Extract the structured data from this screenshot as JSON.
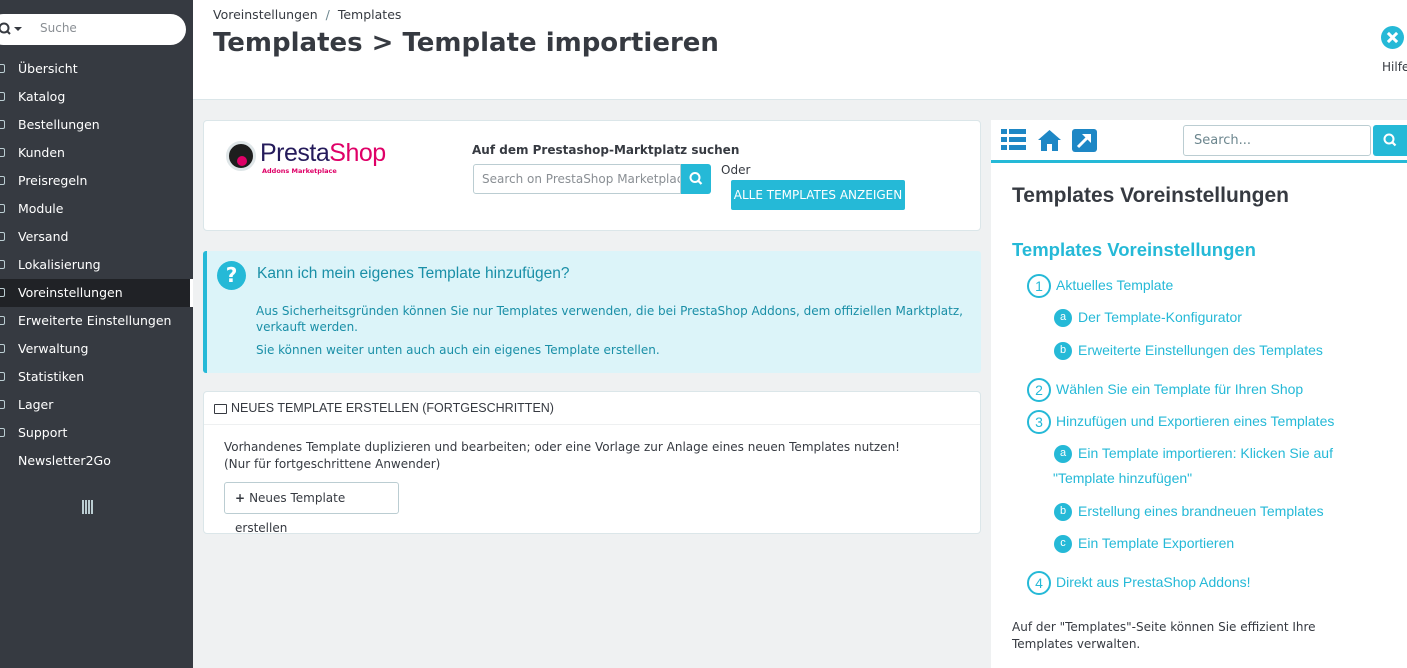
{
  "sidebar": {
    "search_placeholder": "Suche",
    "items": [
      {
        "label": "Übersicht"
      },
      {
        "label": "Katalog"
      },
      {
        "label": "Bestellungen"
      },
      {
        "label": "Kunden"
      },
      {
        "label": "Preisregeln"
      },
      {
        "label": "Module"
      },
      {
        "label": "Versand"
      },
      {
        "label": "Lokalisierung"
      },
      {
        "label": "Voreinstellungen"
      },
      {
        "label": "Erweiterte Einstellungen"
      },
      {
        "label": "Verwaltung"
      },
      {
        "label": "Statistiken"
      },
      {
        "label": "Lager"
      },
      {
        "label": "Support"
      },
      {
        "label": "Newsletter2Go"
      }
    ],
    "active_item": "Voreinstellungen"
  },
  "header": {
    "breadcrumb": [
      "Voreinstellungen",
      "/",
      "Templates"
    ],
    "title": "Templates > Template importieren",
    "help_label": "Hilfe"
  },
  "addons": {
    "logo_brand_a": "Presta",
    "logo_brand_b": "Shop",
    "logo_sub": "Addons Marketplace",
    "search_label": "Auf dem Prestashop-Marktplatz suchen",
    "search_placeholder": "Search on PrestaShop Marketplace",
    "or_label": "Oder",
    "all_templates_button": "ALLE TEMPLATES ANZEIGEN"
  },
  "info": {
    "title": "Kann ich mein eigenes Template hinzufügen?",
    "text1": "Aus Sicherheitsgründen können Sie nur Templates verwenden, die bei PrestaShop Addons, dem offiziellen Marktplatz, verkauft werden.",
    "text2": "Sie können weiter unten auch auch ein eigenes Template erstellen."
  },
  "new_template": {
    "panel_title": "NEUES TEMPLATE ERSTELLEN (FORTGESCHRITTEN)",
    "description": "Vorhandenes Template duplizieren und bearbeiten; oder eine Vorlage zur Anlage eines neuen Templates nutzen! (Nur für fortgeschrittene Anwender)",
    "button_plus": "+",
    "button_label": "Neues Template erstellen"
  },
  "help": {
    "search_placeholder": "Search...",
    "heading": "Templates Voreinstellungen",
    "subheading": "Templates Voreinstellungen",
    "toc": [
      {
        "marker": "1",
        "label": "Aktuelles Template"
      },
      {
        "marker": "a",
        "label": "Der Template-Konfigurator"
      },
      {
        "marker": "b",
        "label": "Erweiterte Einstellungen des Templates"
      },
      {
        "marker": "2",
        "label": "Wählen Sie ein Template für Ihren Shop"
      },
      {
        "marker": "3",
        "label": "Hinzufügen und Exportieren eines Templates"
      },
      {
        "marker": "a",
        "label": "Ein Template importieren: Klicken Sie auf"
      },
      {
        "marker": "",
        "label": "\"Template hinzufügen\""
      },
      {
        "marker": "b",
        "label": "Erstellung eines brandneuen Templates"
      },
      {
        "marker": "c",
        "label": "Ein Template Exportieren"
      },
      {
        "marker": "4",
        "label": "Direkt aus PrestaShop Addons!"
      }
    ],
    "footer": "Auf der \"Templates\"-Seite können Sie effizient Ihre Templates verwalten."
  },
  "colors": {
    "accent": "#25b9d7",
    "sidebar_bg": "#363a41",
    "sidebar_active_bg": "#202226",
    "page_bg": "#eff1f2",
    "info_bg": "#dcf4f9",
    "info_text": "#1a8fa7",
    "brand_pink": "#df0067"
  }
}
